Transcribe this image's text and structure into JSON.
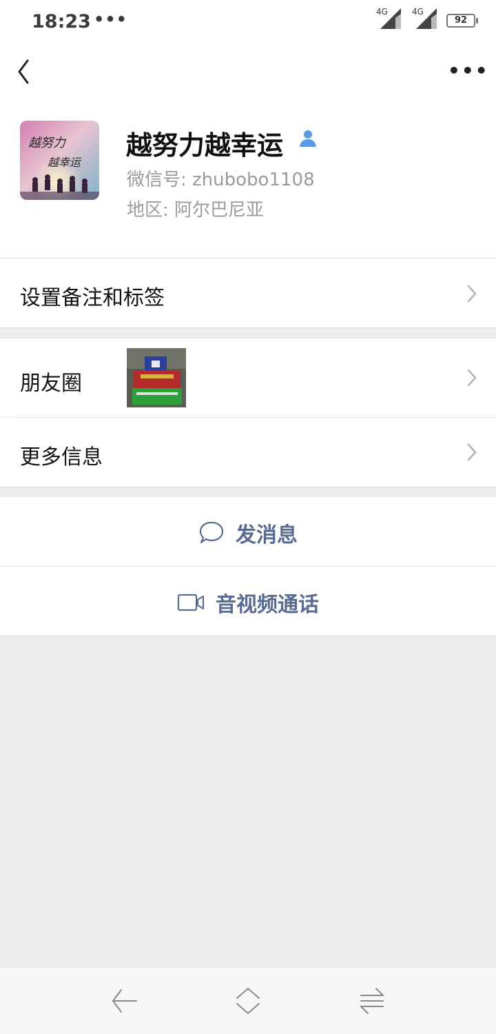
{
  "status_bar": {
    "time": "18:23",
    "notification_dots": "•••",
    "signal_1_label": "4G",
    "signal_2_label": "4G",
    "battery_level": "92"
  },
  "nav": {
    "back_icon": "chevron-left-icon",
    "more_label": "•••"
  },
  "profile": {
    "name": "越努力越幸运",
    "wechat_id_label": "微信号:",
    "wechat_id": "zhubobo1108",
    "region_label": "地区:",
    "region": "阿尔巴尼亚",
    "avatar_caption_line1": "越努力",
    "avatar_caption_line2": "越幸运"
  },
  "rows": [
    {
      "label": "设置备注和标签"
    },
    {
      "label": "朋友圈"
    },
    {
      "label": "更多信息"
    }
  ],
  "actions": {
    "send_message": "发消息",
    "video_call": "音视频通话"
  },
  "colors": {
    "accent": "#576b95",
    "background": "#ececec",
    "person_icon": "#5b9be6"
  }
}
